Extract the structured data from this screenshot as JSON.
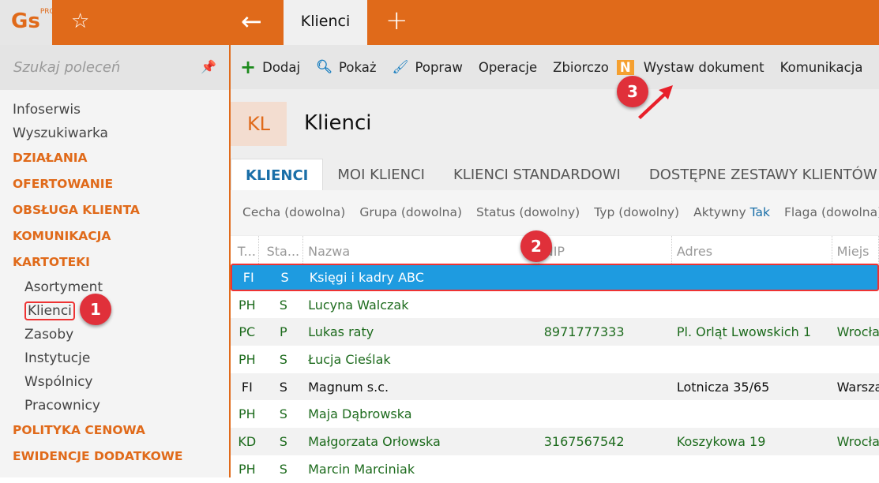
{
  "app": {
    "logo": "Gs",
    "logo_sup": "PRO",
    "tab": "Klienci"
  },
  "sidebar": {
    "search_placeholder": "Szukaj poleceń",
    "items": [
      {
        "label": "Infoserwis",
        "type": "item"
      },
      {
        "label": "Wyszukiwarka",
        "type": "item"
      },
      {
        "label": "DZIAŁANIA",
        "type": "sec"
      },
      {
        "label": "OFERTOWANIE",
        "type": "sec"
      },
      {
        "label": "OBSŁUGA KLIENTA",
        "type": "sec"
      },
      {
        "label": "KOMUNIKACJA",
        "type": "sec"
      },
      {
        "label": "KARTOTEKI",
        "type": "sec"
      },
      {
        "label": "Asortyment",
        "type": "sub"
      },
      {
        "label": "Klienci",
        "type": "sub active"
      },
      {
        "label": "Zasoby",
        "type": "sub"
      },
      {
        "label": "Instytucje",
        "type": "sub"
      },
      {
        "label": "Wspólnicy",
        "type": "sub"
      },
      {
        "label": "Pracownicy",
        "type": "sub"
      },
      {
        "label": "POLITYKA CENOWA",
        "type": "sec"
      },
      {
        "label": "EWIDENCJE DODATKOWE",
        "type": "sec"
      }
    ]
  },
  "toolbar": {
    "add": "Dodaj",
    "show": "Pokaż",
    "edit": "Popraw",
    "operations": "Operacje",
    "summary": "Zbiorczo",
    "badge": "N",
    "issue_document": "Wystaw dokument",
    "communication": "Komunikacja"
  },
  "header": {
    "abbr": "KL",
    "title": "Klienci"
  },
  "tabs": [
    "KLIENCI",
    "MOI KLIENCI",
    "KLIENCI STANDARDOWI",
    "DOSTĘPNE ZESTAWY KLIENTÓW"
  ],
  "filters": {
    "f1": "Cecha (dowolna)",
    "f2": "Grupa (dowolna)",
    "f3": "Status (dowolny)",
    "f4": "Typ (dowolny)",
    "f5": "Aktywny",
    "f5v": "Tak",
    "f6": "Flaga (dowolna)"
  },
  "columns": [
    "T...",
    "Sta...",
    "Nazwa",
    "NIP",
    "Adres",
    "Miejs"
  ],
  "rows": [
    [
      "FI",
      "S",
      "Księgi i kadry ABC",
      "",
      "",
      ""
    ],
    [
      "PH",
      "S",
      "Lucyna Walczak",
      "",
      "",
      ""
    ],
    [
      "PC",
      "P",
      "Lukas raty",
      "8971777333",
      "Pl. Orląt Lwowskich 1",
      "Wrocław"
    ],
    [
      "PH",
      "S",
      "Łucja Cieślak",
      "",
      "",
      ""
    ],
    [
      "FI",
      "S",
      "Magnum s.c.",
      "",
      "Lotnicza  35/65",
      "Warszawa"
    ],
    [
      "PH",
      "S",
      "Maja Dąbrowska",
      "",
      "",
      ""
    ],
    [
      "KD",
      "S",
      "Małgorzata Orłowska",
      "3167567542",
      "Koszykowa 19",
      "Wrocław"
    ],
    [
      "PH",
      "S",
      "Marcin Marciniak",
      "",
      "",
      ""
    ]
  ],
  "markers": [
    "1",
    "2",
    "3"
  ],
  "colors": {
    "accent": "#e06a1a",
    "selection": "#1e9be0",
    "marker": "#e0303a"
  }
}
